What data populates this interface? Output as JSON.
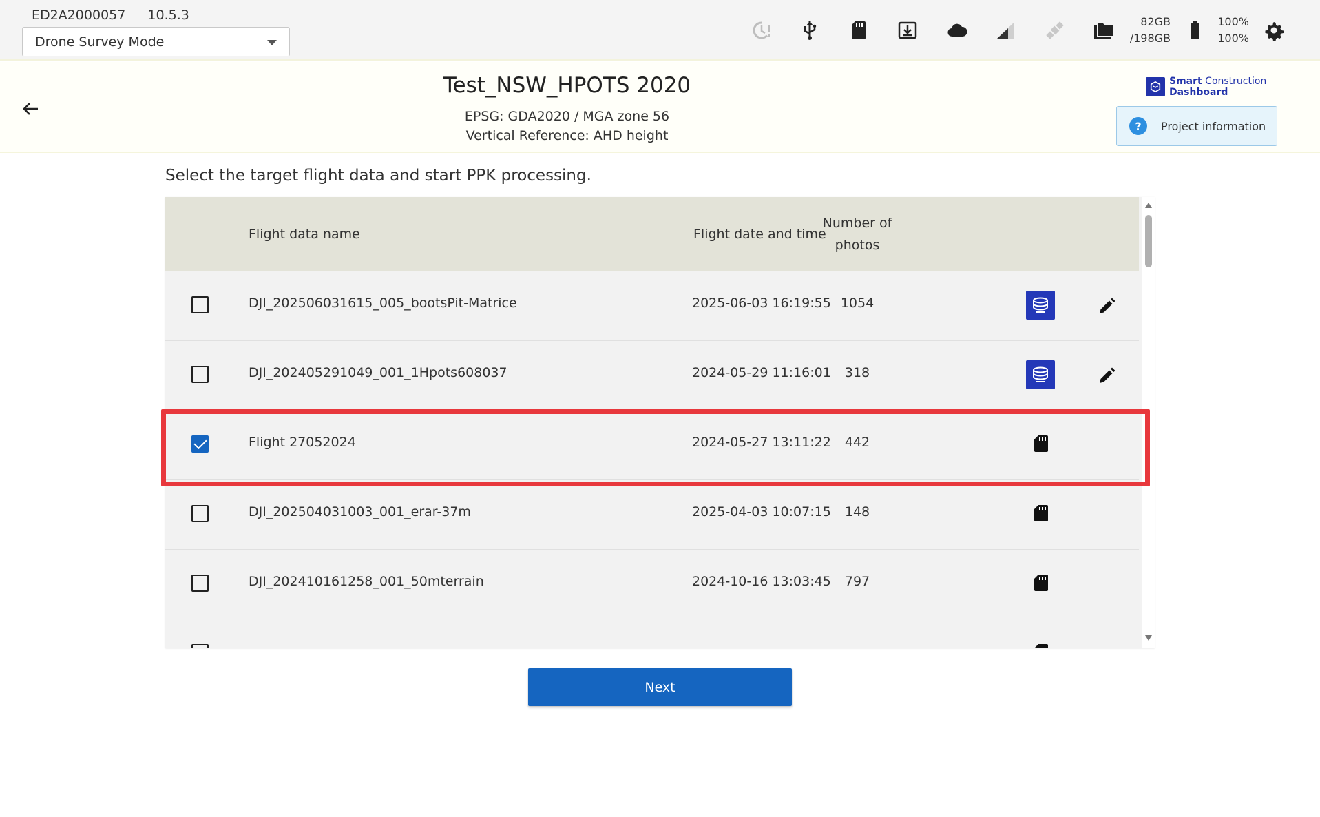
{
  "device": {
    "serial": "ED2A2000057",
    "version": "10.5.3"
  },
  "mode_select": {
    "value": "Drone Survey Mode"
  },
  "status": {
    "storage_used": "82GB",
    "storage_total": "/198GB",
    "battery_1": "100%",
    "battery_2": "100%",
    "icons": [
      "sync-alert-icon",
      "usb-icon",
      "sd-card-icon",
      "download-icon",
      "cloud-icon",
      "signal-icon",
      "satellite-icon",
      "folder-icon",
      "battery-icon",
      "gear-icon"
    ]
  },
  "project": {
    "title": "Test_NSW_HPOTS 2020",
    "epsg": "EPSG: GDA2020 / MGA zone 56",
    "vertical": "Vertical Reference: AHD height",
    "logo_line1_bold": "Smart",
    "logo_line1_rest": " Construction",
    "logo_line2": "Dashboard",
    "info_button": "Project information"
  },
  "instruction": "Select the target flight data and start PPK processing.",
  "table": {
    "headers": {
      "name": "Flight data name",
      "date": "Flight date and time",
      "photos_line1": "Number of",
      "photos_line2": "photos"
    },
    "rows": [
      {
        "name": "DJI_202506031615_005_bootsPit-Matrice",
        "date": "2025-06-03 16:19:55",
        "photos": "1054",
        "checked": false,
        "source": "cloud-db",
        "editable": true
      },
      {
        "name": "DJI_202405291049_001_1Hpots608037",
        "date": "2024-05-29 11:16:01",
        "photos": "318",
        "checked": false,
        "source": "cloud-db",
        "editable": true
      },
      {
        "name": "Flight 27052024",
        "date": "2024-05-27 13:11:22",
        "photos": "442",
        "checked": true,
        "source": "sd-card",
        "editable": false
      },
      {
        "name": "DJI_202504031003_001_erar-37m",
        "date": "2025-04-03 10:07:15",
        "photos": "148",
        "checked": false,
        "source": "sd-card",
        "editable": false
      },
      {
        "name": "DJI_202410161258_001_50mterrain",
        "date": "2024-10-16 13:03:45",
        "photos": "797",
        "checked": false,
        "source": "sd-card",
        "editable": false
      }
    ]
  },
  "next_button": "Next",
  "colors": {
    "primary": "#1565c0",
    "highlight": "#e8383d",
    "header_bg": "#e3e3d8"
  }
}
